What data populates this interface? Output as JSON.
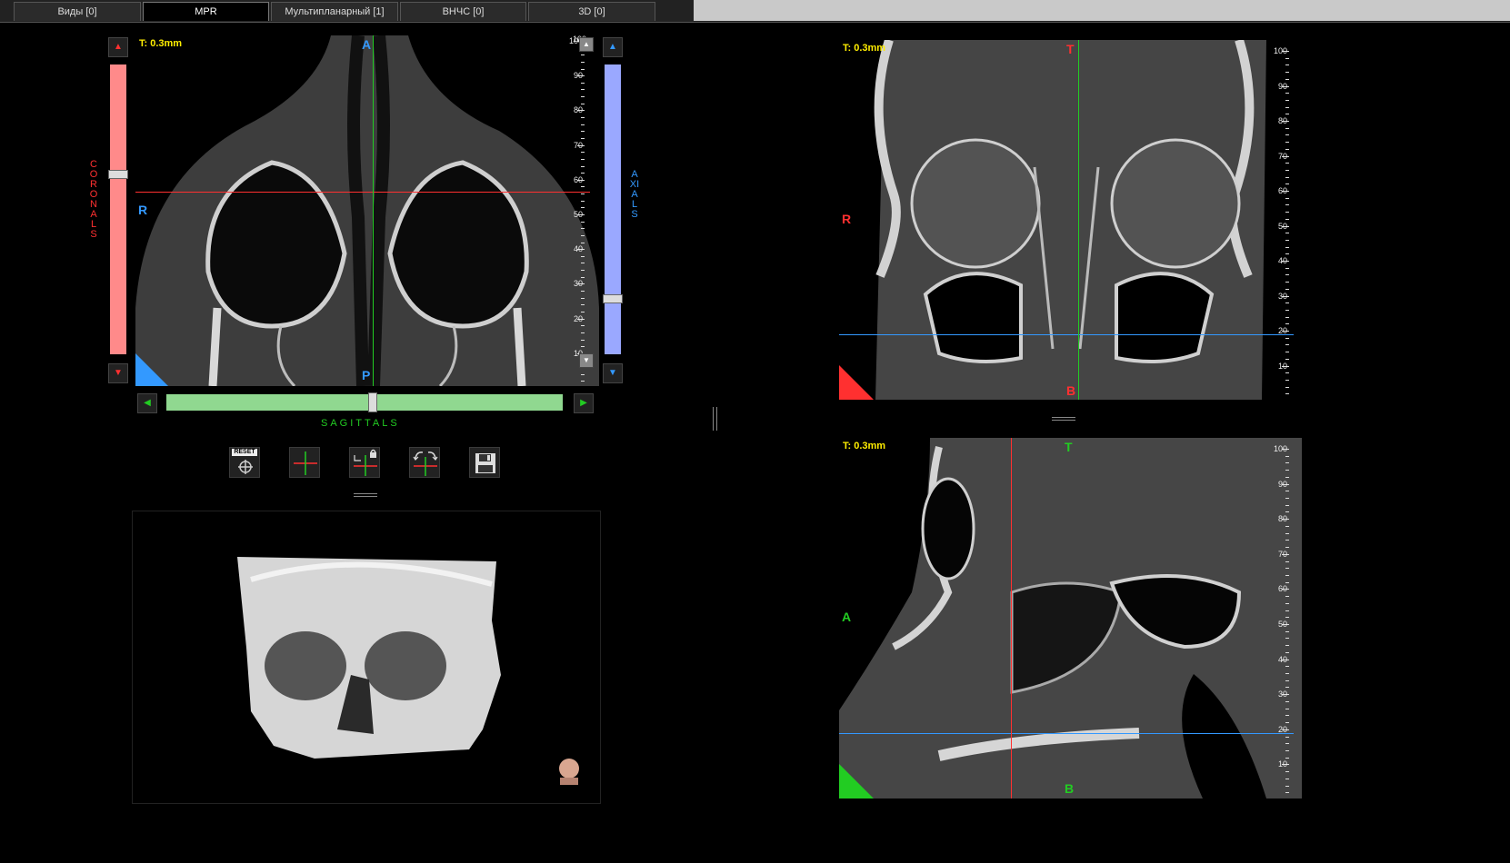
{
  "tabs": [
    {
      "label": "Виды [0]",
      "active": false
    },
    {
      "label": "MPR",
      "active": true
    },
    {
      "label": "Мультипланарный [1]",
      "active": false
    },
    {
      "label": "ВНЧС [0]",
      "active": false
    },
    {
      "label": "3D [0]",
      "active": false
    }
  ],
  "axial_view": {
    "thickness": "T: 0.3mm",
    "orient_top": "A",
    "orient_bottom": "P",
    "orient_left": "R",
    "ruler_labels": [
      "10",
      "20",
      "30",
      "40",
      "50",
      "60",
      "70",
      "80",
      "90",
      "100"
    ],
    "ruler_top_partial": "100"
  },
  "coronal_view": {
    "thickness": "T: 0.3mm",
    "orient_top": "T",
    "orient_bottom": "B",
    "orient_left": "R",
    "ruler_labels": [
      "10",
      "20",
      "30",
      "40",
      "50",
      "60",
      "70",
      "80",
      "90",
      "100"
    ]
  },
  "sagittal_view": {
    "thickness": "T: 0.3mm",
    "orient_top": "T",
    "orient_bottom": "B",
    "orient_left": "A",
    "ruler_labels": [
      "10",
      "20",
      "30",
      "40",
      "50",
      "60",
      "70",
      "80",
      "90",
      "100"
    ]
  },
  "sliders": {
    "coronals_label": "CORONALS",
    "axials_label": "AXIALS",
    "sagittals_label": "SAGITTALS",
    "coronals_position": 0.38,
    "axials_position": 0.81,
    "sagittals_position": 0.52
  },
  "toolbar": {
    "reset_label": "RESET"
  },
  "colors": {
    "coronal": "#ff3030",
    "axial": "#3399ff",
    "sagittal": "#22cc22",
    "label_yellow": "#ffee00"
  }
}
